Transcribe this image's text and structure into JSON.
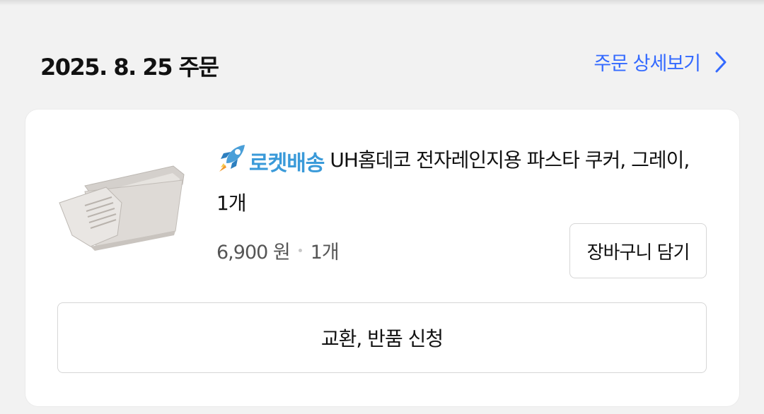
{
  "order": {
    "date_label": "2025. 8. 25 주문",
    "detail_link_label": "주문 상세보기"
  },
  "item": {
    "badge_label": "로켓배송",
    "product_name": "UH홈데코 전자레인지용 파스타 쿠커, 그레이, 1개",
    "price": "6,900 원",
    "quantity": "1개",
    "cart_button_label": "장바구니 담기"
  },
  "actions": {
    "return_button_label": "교환, 반품 신청"
  },
  "colors": {
    "link": "#346aff",
    "rocket_badge": "#3a9ad9",
    "background": "#f2f2f2"
  },
  "icons": {
    "detail_chevron": "chevron-right-icon",
    "rocket": "rocket-icon"
  }
}
